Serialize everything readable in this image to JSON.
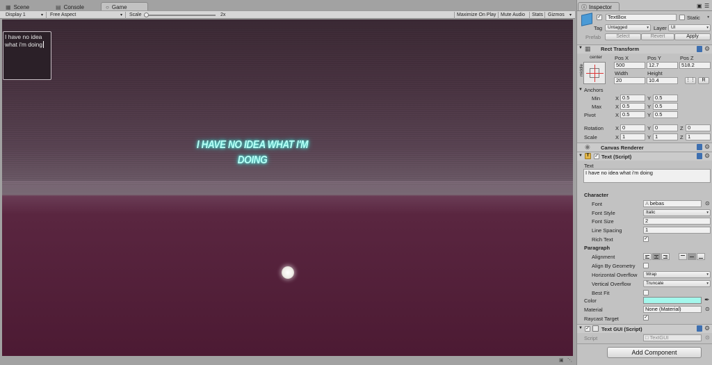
{
  "tabs": {
    "scene": "Scene",
    "console": "Console",
    "game": "Game"
  },
  "toolbar": {
    "display": "Display 1",
    "aspect": "Free Aspect",
    "scale_label": "Scale",
    "scale_value": "2x",
    "scale_level": 0.02,
    "maximize": "Maximize On Play",
    "mute": "Mute Audio",
    "stats": "Stats",
    "gizmos": "Gizmos"
  },
  "game": {
    "textbox": "I have no idea what i'm doing",
    "glow_line1": "I HAVE NO IDEA WHAT I'M",
    "glow_line2": "DOING"
  },
  "colors": {
    "glow": "#b6fff6",
    "text_color_swatch": "#a4f7ec",
    "sky": "#4a3442",
    "ground": "#4c1a33"
  },
  "inspector": {
    "tab": "Inspector",
    "object_name": "TextBox",
    "static_label": "Static",
    "tag_label": "Tag",
    "tag_value": "Untagged",
    "layer_label": "Layer",
    "layer_value": "UI",
    "prefab_label": "Prefab",
    "select": "Select",
    "revert": "Revert",
    "apply": "Apply",
    "rect": {
      "title": "Rect Transform",
      "anchor_h": "center",
      "anchor_v": "middle",
      "pos_x_label": "Pos X",
      "pos_y_label": "Pos Y",
      "pos_z_label": "Pos Z",
      "pos_x": "500",
      "pos_y": "12.7",
      "pos_z": "518.2",
      "width_label": "Width",
      "height_label": "Height",
      "width": "20",
      "height": "10.4",
      "r_btn": "R",
      "anchors": "Anchors",
      "min": "Min",
      "max": "Max",
      "pivot": "Pivot",
      "x": "X",
      "y": "Y",
      "z": "Z",
      "min_x": "0.5",
      "min_y": "0.5",
      "max_x": "0.5",
      "max_y": "0.5",
      "pivot_x": "0.5",
      "pivot_y": "0.5",
      "rotation": "Rotation",
      "scale": "Scale",
      "rot_x": "0",
      "rot_y": "0",
      "rot_z": "0",
      "scale_x": "1",
      "scale_y": "1",
      "scale_z": "1"
    },
    "canvas_renderer": "Canvas Renderer",
    "text_script": {
      "title": "Text (Script)",
      "text_label": "Text",
      "text_value": "I have no idea what i'm doing",
      "character": "Character",
      "font_label": "Font",
      "font_value": "bebas",
      "font_style_label": "Font Style",
      "font_style_value": "Italic",
      "font_size_label": "Font Size",
      "font_size_value": "2",
      "line_spacing_label": "Line Spacing",
      "line_spacing_value": "1",
      "rich_text_label": "Rich Text",
      "paragraph": "Paragraph",
      "alignment_label": "Alignment",
      "align_by_geometry_label": "Align By Geometry",
      "h_overflow_label": "Horizontal Overflow",
      "h_overflow_value": "Wrap",
      "v_overflow_label": "Vertical Overflow",
      "v_overflow_value": "Truncate",
      "best_fit_label": "Best Fit",
      "color_label": "Color",
      "material_label": "Material",
      "material_value": "None (Material)",
      "raycast_label": "Raycast Target"
    },
    "text_gui": {
      "title": "Text GUI (Script)",
      "script_label": "Script",
      "script_value": "TextGUI"
    },
    "add_component": "Add Component"
  },
  "icons": {
    "scene": "scene-icon",
    "console": "console-icon",
    "game": "game-icon",
    "inspector": "inspector-icon",
    "gameobject": "cube-icon",
    "help": "book-icon",
    "settings": "gear-icon",
    "lock": "lock-icon"
  }
}
